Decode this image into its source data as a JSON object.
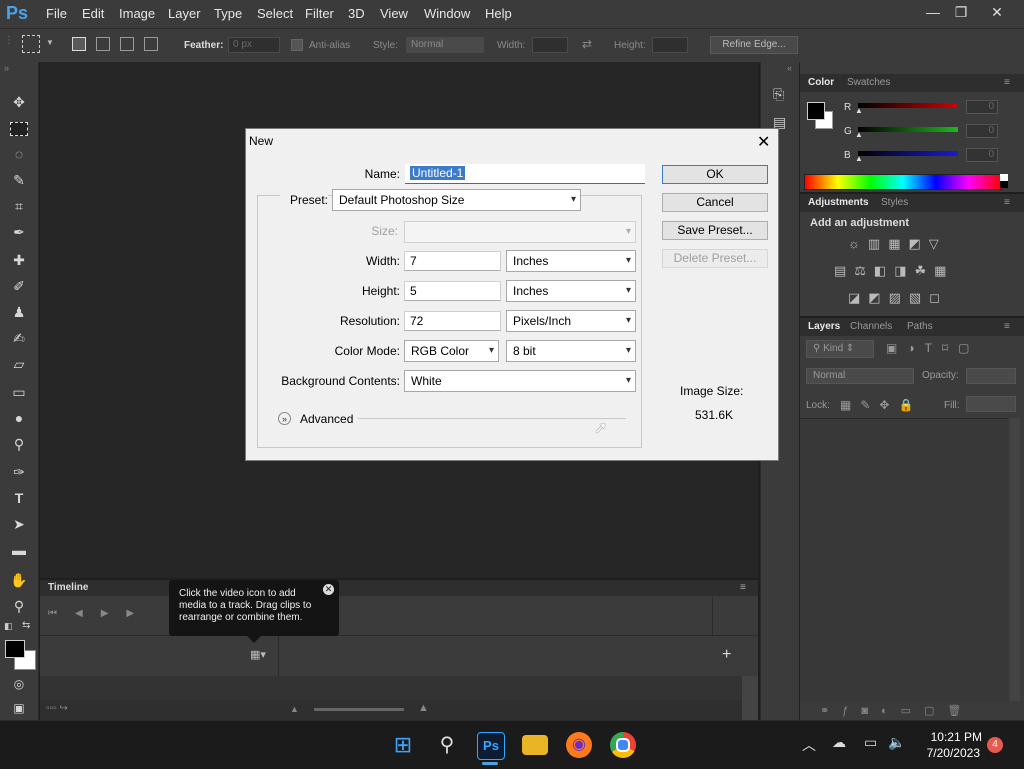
{
  "app": {
    "logo": "Ps"
  },
  "menu": [
    "File",
    "Edit",
    "Image",
    "Layer",
    "Type",
    "Select",
    "Filter",
    "3D",
    "View",
    "Window",
    "Help"
  ],
  "window_controls": {
    "minimize": "—",
    "restore": "❐",
    "close": "✕"
  },
  "options_bar": {
    "feather_label": "Feather:",
    "feather_value": "0 px",
    "antialias_label": "Anti-alias",
    "style_label": "Style:",
    "style_value": "Normal",
    "width_label": "Width:",
    "height_label": "Height:",
    "refine_edge": "Refine Edge..."
  },
  "color_panel": {
    "tabs": [
      "Color",
      "Swatches"
    ],
    "channels": [
      "R",
      "G",
      "B"
    ],
    "values": [
      "0",
      "0",
      "0"
    ],
    "colors": {
      "r": "#d40000",
      "g": "#1fb81f",
      "b": "#1a1ad8"
    }
  },
  "adjustments_panel": {
    "tabs": [
      "Adjustments",
      "Styles"
    ],
    "heading": "Add an adjustment"
  },
  "layers_panel": {
    "tabs": [
      "Layers",
      "Channels",
      "Paths"
    ],
    "kind": "Kind",
    "blend_mode": "Normal",
    "opacity_label": "Opacity:",
    "lock_label": "Lock:",
    "fill_label": "Fill:"
  },
  "timeline": {
    "title": "Timeline",
    "tooltip": "Click the video icon to add media to a track. Drag clips to rearrange or combine them."
  },
  "dialog": {
    "title": "New",
    "name_label": "Name:",
    "name_value": "Untitled-1",
    "preset_label": "Preset:",
    "preset_value": "Default Photoshop Size",
    "size_label": "Size:",
    "width_label": "Width:",
    "width_value": "7",
    "width_unit": "Inches",
    "height_label": "Height:",
    "height_value": "5",
    "height_unit": "Inches",
    "resolution_label": "Resolution:",
    "resolution_value": "72",
    "resolution_unit": "Pixels/Inch",
    "color_mode_label": "Color Mode:",
    "color_mode_value": "RGB Color",
    "bit_depth": "8 bit",
    "background_label": "Background Contents:",
    "background_value": "White",
    "advanced_label": "Advanced",
    "ok": "OK",
    "cancel": "Cancel",
    "save_preset": "Save Preset...",
    "delete_preset": "Delete Preset...",
    "image_size_label": "Image Size:",
    "image_size_value": "531.6K"
  },
  "taskbar": {
    "time": "10:21 PM",
    "date": "7/20/2023",
    "notification_count": "4"
  }
}
